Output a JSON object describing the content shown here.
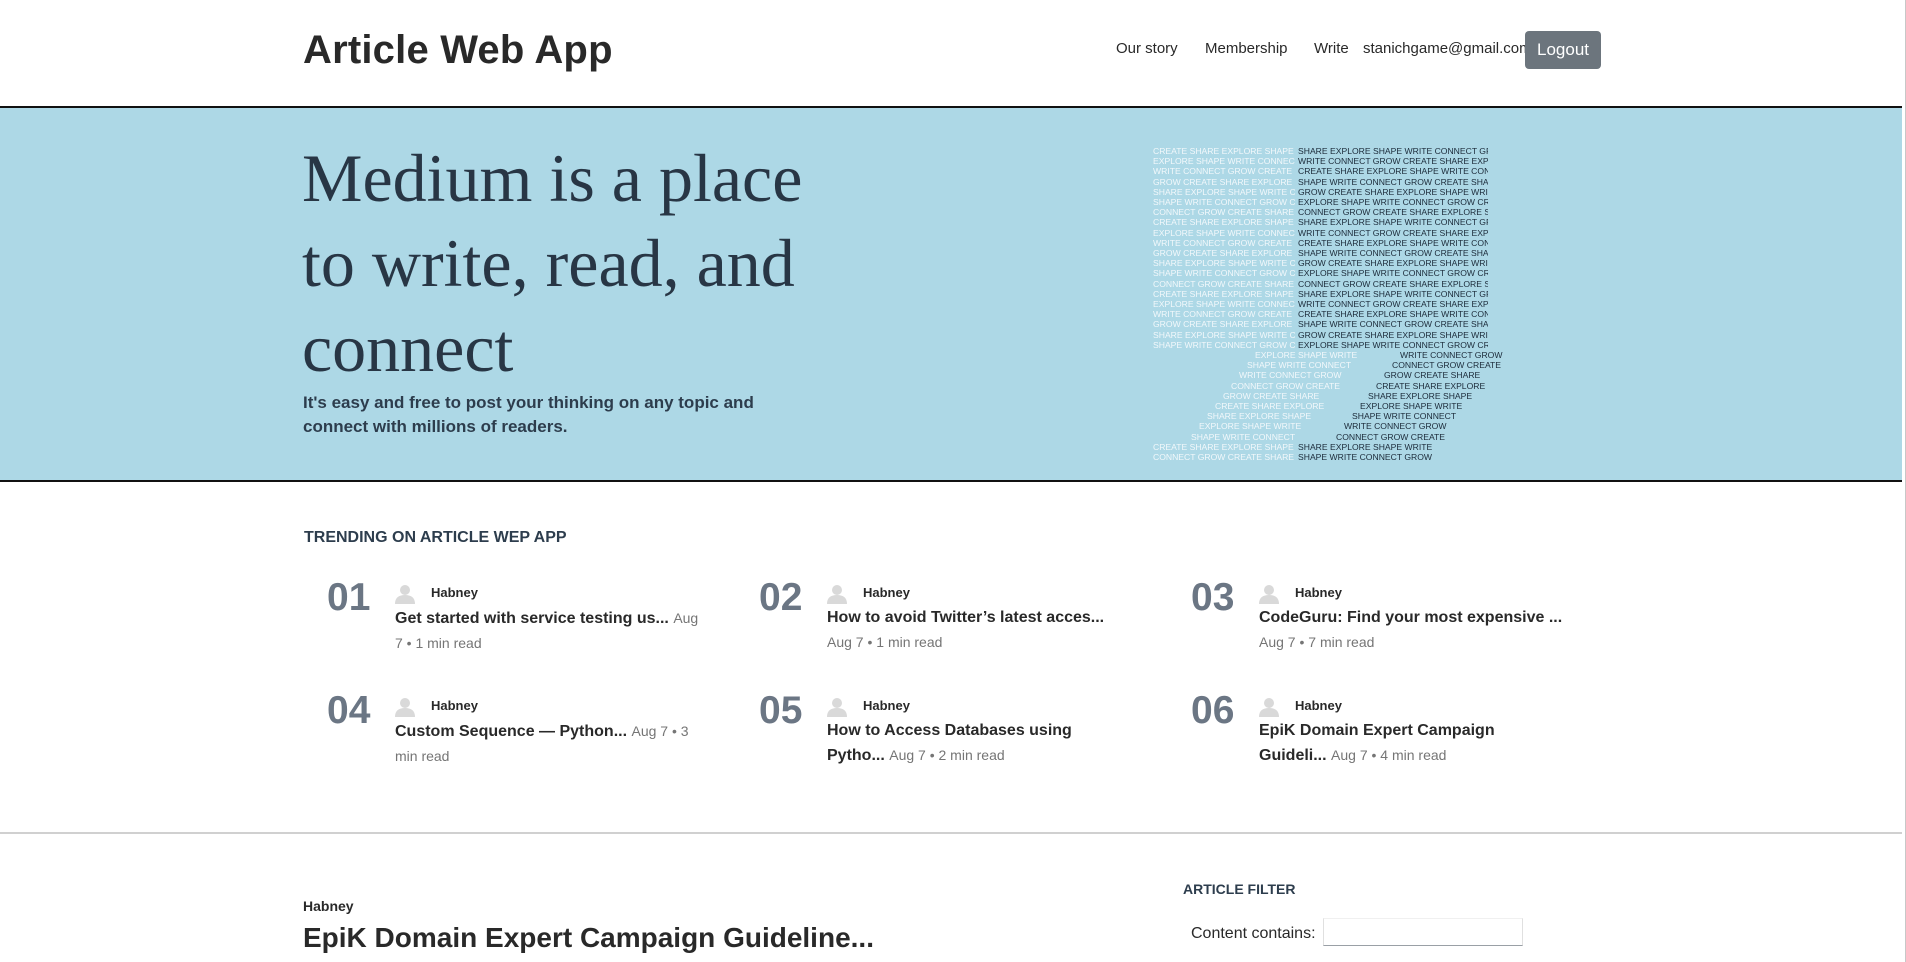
{
  "header": {
    "brand": "Article Web App",
    "nav": [
      "Our story",
      "Membership",
      "Write"
    ],
    "user_email": "stanichgame@gmail.com",
    "logout_label": "Logout"
  },
  "hero": {
    "title": "Medium is a place to write, read, and connect",
    "subtitle": "It's easy and free to post your thinking on any topic and connect with millions of readers.",
    "art_text": "CREATE SHARE EXPLORE SHAPE WRITE CONNECT GROW"
  },
  "trending": {
    "heading": "TRENDING ON ARTICLE WEP APP",
    "items": [
      {
        "num": "01",
        "author": "Habney",
        "title": "Get started with service testing us...",
        "meta": "Aug 7 • 1 min read"
      },
      {
        "num": "02",
        "author": "Habney",
        "title": "How to avoid Twitter’s latest acces...",
        "meta": "Aug 7 • 1 min read"
      },
      {
        "num": "03",
        "author": "Habney",
        "title": "CodeGuru: Find your most expensive ...",
        "meta": "Aug 7 • 7 min read"
      },
      {
        "num": "04",
        "author": "Habney",
        "title": "Custom Sequence — Python...",
        "meta": "Aug 7 • 3 min read"
      },
      {
        "num": "05",
        "author": "Habney",
        "title": "How to Access Databases using Pytho...",
        "meta": "Aug 7 • 2 min read"
      },
      {
        "num": "06",
        "author": "Habney",
        "title": "EpiK Domain Expert Campaign Guideli...",
        "meta": "Aug 7 • 4 min read"
      }
    ]
  },
  "post": {
    "author": "Habney",
    "title": "EpiK Domain Expert Campaign Guideline..."
  },
  "filter": {
    "heading": "ARTICLE FILTER",
    "label": "Content contains:",
    "value": ""
  },
  "colors": {
    "hero_bg": "#add8e6",
    "logout_bg": "#6c757d",
    "trend_number": "#6b7684"
  },
  "icons": [
    "avatar-placeholder-icon"
  ]
}
